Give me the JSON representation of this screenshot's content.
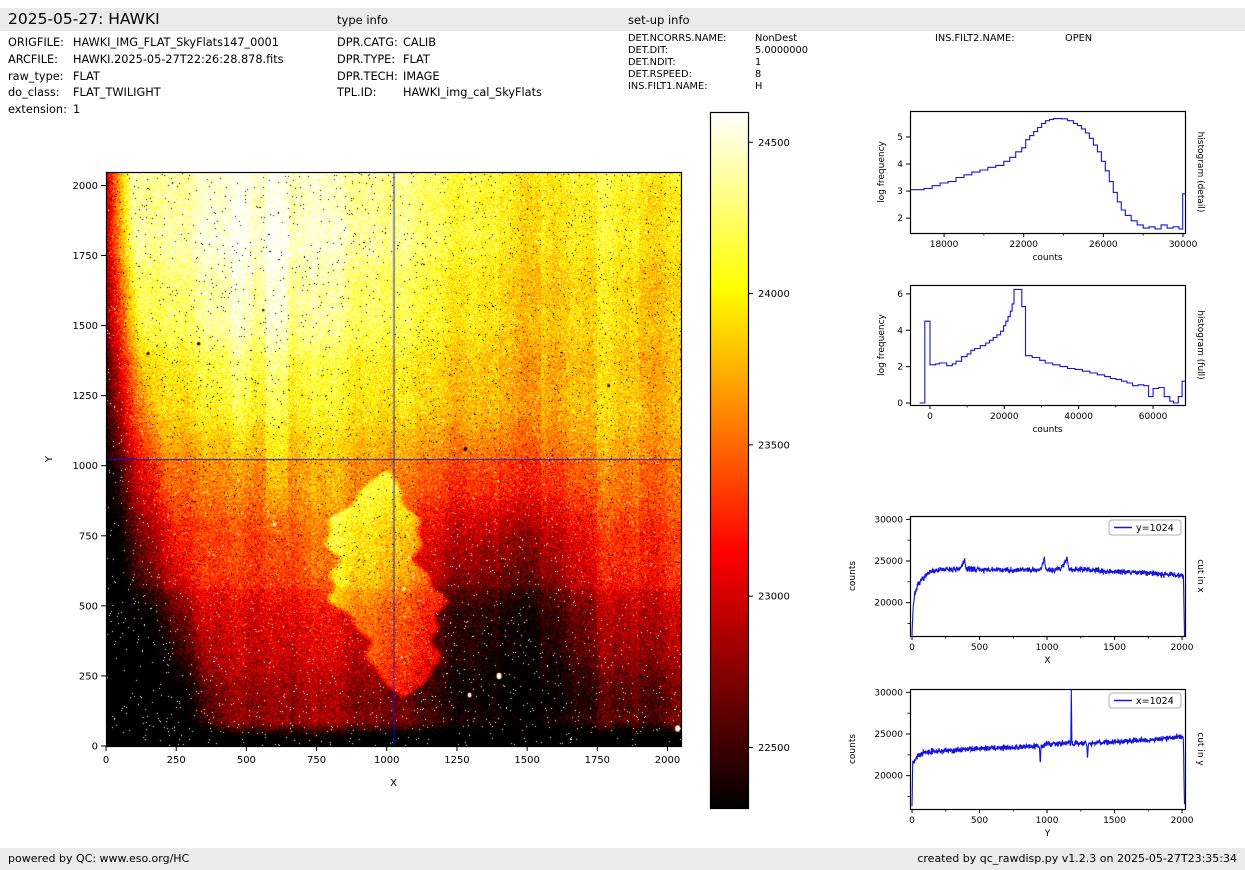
{
  "title": "2025-05-27: HAWKI",
  "sections": {
    "type_info_title": "type info",
    "setup_info_title": "set-up info"
  },
  "file_info": [
    {
      "label": "ORIGFILE:",
      "value": "HAWKI_IMG_FLAT_SkyFlats147_0001"
    },
    {
      "label": "ARCFILE:",
      "value": "HAWKI.2025-05-27T22:26:28.878.fits"
    },
    {
      "label": "raw_type:",
      "value": "FLAT"
    },
    {
      "label": "do_class:",
      "value": "FLAT_TWILIGHT"
    },
    {
      "label": "extension:",
      "value": "1"
    }
  ],
  "type_info": [
    {
      "label": "DPR.CATG:",
      "value": "CALIB"
    },
    {
      "label": "DPR.TYPE:",
      "value": "FLAT"
    },
    {
      "label": "DPR.TECH:",
      "value": "IMAGE"
    },
    {
      "label": "TPL.ID:",
      "value": "HAWKI_img_cal_SkyFlats"
    }
  ],
  "setup_info": [
    {
      "label": "DET.NCORRS.NAME:",
      "value": "NonDest"
    },
    {
      "label": "DET.DIT:",
      "value": "5.0000000"
    },
    {
      "label": "DET.NDIT:",
      "value": "1"
    },
    {
      "label": "DET.RSPEED:",
      "value": "8"
    },
    {
      "label": "INS.FILT1.NAME:",
      "value": "H"
    }
  ],
  "setup_info2": [
    {
      "label": "INS.FILT2.NAME:",
      "value": "OPEN"
    }
  ],
  "footer": {
    "left": "powered by QC: www.eso.org/HC",
    "right": "created by qc_rawdisp.py v1.2.3 on 2025-05-27T23:35:34"
  },
  "colors": {
    "accent_blue": "#1414dd",
    "bar_bg": "#ebebeb",
    "spine": "#000000"
  },
  "chart_data": [
    {
      "id": "main_image",
      "type": "heatmap",
      "colormap": "hot",
      "xlabel": "X",
      "ylabel": "Y",
      "xlim": [
        0,
        2048
      ],
      "ylim": [
        0,
        2048
      ],
      "xticks": [
        0,
        250,
        500,
        750,
        1000,
        1250,
        1500,
        1750,
        2000
      ],
      "yticks": [
        0,
        250,
        500,
        750,
        1000,
        1250,
        1500,
        1750,
        2000
      ],
      "crosshair": {
        "x": 1024,
        "y": 1024
      },
      "colorbar": {
        "vmin": 22300,
        "vmax": 24600,
        "ticks": [
          24500,
          24000,
          23500,
          23000,
          22500
        ]
      },
      "model": {
        "base": 23120,
        "grad": 900,
        "step_y": [
          [
            1024,
            130
          ],
          [
            560,
            70
          ]
        ],
        "bright_gauss": [
          [
            560,
            1800,
            470,
            420,
            600
          ],
          [
            640,
            1280,
            330,
            300,
            160
          ],
          [
            1700,
            1060,
            430,
            260,
            130
          ],
          [
            800,
            760,
            150,
            230,
            230
          ]
        ],
        "dark_gauss": [
          [
            1380,
            430,
            240,
            330,
            -480
          ],
          [
            1650,
            140,
            500,
            210,
            -430
          ],
          [
            60,
            110,
            270,
            260,
            -600
          ],
          [
            1510,
            650,
            270,
            270,
            -180
          ]
        ],
        "left_edge": {
          "w0": 45,
          "w1": 170,
          "pow": 1.6,
          "spread": 2.2,
          "depth": 1400
        },
        "bottom_edge": {
          "h": 90,
          "depth": 1100,
          "pow": 1.2
        },
        "blob": {
          "cx": 1010,
          "sway": 55,
          "sway_p": 160,
          "y0": 170,
          "y1": 985,
          "hw": 185,
          "edge": 22,
          "amp": 540,
          "wob": [
            28,
            41,
            1.3,
            16,
            15.7
          ]
        },
        "stripes": [
          [
            570,
            650,
            150,
            700
          ],
          [
            450,
            520,
            80,
            900
          ],
          [
            1400,
            1550,
            -120,
            0
          ],
          [
            1750,
            1900,
            100,
            0
          ],
          [
            660,
            730,
            -90,
            0
          ]
        ],
        "waves_x": [
          [
            45,
            53,
            0
          ],
          [
            35,
            19,
            2
          ]
        ],
        "waves_y": [
          [
            30,
            47,
            1
          ]
        ],
        "noise": 260,
        "salt": 0.012,
        "pepper": 0.012,
        "bright_spots": [
          [
            1400,
            250,
            2.5
          ],
          [
            1295,
            182,
            2
          ],
          [
            600,
            790,
            1.5
          ],
          [
            2036,
            62,
            2.5
          ],
          [
            1060,
            560,
            1.5
          ]
        ],
        "dark_spots": [
          [
            150,
            1400,
            1.6
          ],
          [
            1280,
            1060,
            2
          ],
          [
            650,
            363,
            1.5
          ],
          [
            560,
            1555,
            1.2
          ],
          [
            1790,
            1285,
            1.5
          ],
          [
            330,
            1435,
            1.8
          ]
        ]
      }
    },
    {
      "id": "histogram_detail",
      "type": "line",
      "step": true,
      "right_label": "histogram (detail)",
      "xlabel": "counts",
      "ylabel": "log frequency",
      "xlim": [
        16290,
        30100
      ],
      "ylim": [
        1.45,
        5.96
      ],
      "xticks_major": [
        18000,
        22000,
        26000,
        30000
      ],
      "xticks_minor": [
        20000,
        24000,
        28000
      ],
      "yticks_major": [
        2,
        3,
        4,
        5
      ],
      "yticks_minor": [],
      "points": [
        [
          16290,
          3.05
        ],
        [
          17000,
          3.1
        ],
        [
          17400,
          3.2
        ],
        [
          17800,
          3.3
        ],
        [
          18200,
          3.35
        ],
        [
          18600,
          3.5
        ],
        [
          19000,
          3.6
        ],
        [
          19400,
          3.7
        ],
        [
          19800,
          3.78
        ],
        [
          20200,
          3.88
        ],
        [
          20600,
          3.95
        ],
        [
          21000,
          4.1
        ],
        [
          21300,
          4.25
        ],
        [
          21600,
          4.45
        ],
        [
          21900,
          4.6
        ],
        [
          22100,
          4.9
        ],
        [
          22300,
          5.05
        ],
        [
          22500,
          5.2
        ],
        [
          22700,
          5.35
        ],
        [
          22900,
          5.5
        ],
        [
          23100,
          5.6
        ],
        [
          23300,
          5.65
        ],
        [
          23500,
          5.68
        ],
        [
          23900,
          5.67
        ],
        [
          24200,
          5.6
        ],
        [
          24500,
          5.5
        ],
        [
          24700,
          5.42
        ],
        [
          24900,
          5.3
        ],
        [
          25100,
          5.15
        ],
        [
          25300,
          4.95
        ],
        [
          25500,
          4.7
        ],
        [
          25700,
          4.45
        ],
        [
          25900,
          4.1
        ],
        [
          26100,
          3.75
        ],
        [
          26300,
          3.35
        ],
        [
          26500,
          2.95
        ],
        [
          26700,
          2.6
        ],
        [
          26900,
          2.3
        ],
        [
          27100,
          2.1
        ],
        [
          27400,
          1.9
        ],
        [
          27700,
          1.75
        ],
        [
          28000,
          1.63
        ],
        [
          28300,
          1.68
        ],
        [
          28600,
          1.6
        ],
        [
          28900,
          1.75
        ],
        [
          29200,
          1.63
        ],
        [
          29500,
          1.68
        ],
        [
          29800,
          1.6
        ],
        [
          29985,
          2.9
        ],
        [
          30100,
          2.9
        ]
      ]
    },
    {
      "id": "histogram_full",
      "type": "line",
      "step": true,
      "right_label": "histogram (full)",
      "xlabel": "counts",
      "ylabel": "log frequency",
      "xlim": [
        -5370,
        68590
      ],
      "ylim": [
        -0.11,
        6.49
      ],
      "xticks_major": [
        0,
        20000,
        40000,
        60000
      ],
      "xticks_minor": [
        10000,
        30000,
        50000
      ],
      "yticks_major": [
        0,
        2,
        4,
        6
      ],
      "yticks_minor": [],
      "points": [
        [
          -2800,
          0
        ],
        [
          -1400,
          4.5
        ],
        [
          0,
          2.1
        ],
        [
          1500,
          2.15
        ],
        [
          2500,
          2.2
        ],
        [
          4500,
          2.05
        ],
        [
          6000,
          2.15
        ],
        [
          7000,
          2.3
        ],
        [
          8500,
          2.55
        ],
        [
          10000,
          2.7
        ],
        [
          11000,
          2.9
        ],
        [
          12000,
          3.0
        ],
        [
          13500,
          3.15
        ],
        [
          15000,
          3.3
        ],
        [
          16000,
          3.45
        ],
        [
          17000,
          3.6
        ],
        [
          18000,
          3.75
        ],
        [
          19000,
          3.95
        ],
        [
          19800,
          4.25
        ],
        [
          20400,
          4.5
        ],
        [
          21000,
          4.75
        ],
        [
          21600,
          5.05
        ],
        [
          22100,
          5.45
        ],
        [
          22600,
          6.25
        ],
        [
          24700,
          5.3
        ],
        [
          25700,
          2.6
        ],
        [
          27500,
          2.5
        ],
        [
          29500,
          2.35
        ],
        [
          31000,
          2.2
        ],
        [
          33000,
          2.1
        ],
        [
          35000,
          2.0
        ],
        [
          37000,
          1.9
        ],
        [
          39000,
          1.85
        ],
        [
          41000,
          1.75
        ],
        [
          43000,
          1.65
        ],
        [
          45000,
          1.55
        ],
        [
          47000,
          1.45
        ],
        [
          48500,
          1.35
        ],
        [
          50000,
          1.3
        ],
        [
          51500,
          1.2
        ],
        [
          53000,
          1.1
        ],
        [
          54500,
          0.95
        ],
        [
          56000,
          1.0
        ],
        [
          57500,
          0.95
        ],
        [
          58800,
          0.35
        ],
        [
          60000,
          0.8
        ],
        [
          61500,
          0.85
        ],
        [
          63000,
          0.35
        ],
        [
          64500,
          0.1
        ],
        [
          65500,
          0.0
        ],
        [
          66800,
          0.35
        ],
        [
          67800,
          1.2
        ],
        [
          68590,
          1.2
        ]
      ]
    },
    {
      "id": "cut_in_x",
      "type": "line",
      "step": false,
      "legend": "y=1024",
      "right_label": "cut in x",
      "xlabel": "X",
      "ylabel": "counts",
      "xlim": [
        -15,
        2022
      ],
      "ylim": [
        16000,
        30400
      ],
      "xticks_major": [
        0,
        500,
        1000,
        1500,
        2000
      ],
      "xticks_minor": [
        250,
        750,
        1250,
        1750
      ],
      "yticks_major": [
        20000,
        25000,
        30000
      ],
      "yticks_minor": [
        17500,
        22500,
        27500
      ],
      "noise_sigma": 330,
      "noise_seed": 7,
      "base_points": [
        [
          0,
          16200
        ],
        [
          8,
          19500
        ],
        [
          20,
          21000
        ],
        [
          40,
          22000
        ],
        [
          70,
          22700
        ],
        [
          100,
          23200
        ],
        [
          140,
          23700
        ],
        [
          180,
          23900
        ],
        [
          250,
          24000
        ],
        [
          350,
          23950
        ],
        [
          390,
          25100
        ],
        [
          400,
          24000
        ],
        [
          450,
          24050
        ],
        [
          550,
          23900
        ],
        [
          650,
          23950
        ],
        [
          750,
          23900
        ],
        [
          850,
          24000
        ],
        [
          950,
          23900
        ],
        [
          980,
          25300
        ],
        [
          990,
          24000
        ],
        [
          1050,
          23950
        ],
        [
          1100,
          24050
        ],
        [
          1150,
          25400
        ],
        [
          1160,
          24050
        ],
        [
          1200,
          24000
        ],
        [
          1300,
          23950
        ],
        [
          1400,
          23800
        ],
        [
          1500,
          23750
        ],
        [
          1600,
          23700
        ],
        [
          1700,
          23600
        ],
        [
          1800,
          23500
        ],
        [
          1900,
          23400
        ],
        [
          1975,
          23300
        ],
        [
          2010,
          23250
        ],
        [
          2018,
          16300
        ]
      ]
    },
    {
      "id": "cut_in_y",
      "type": "line",
      "step": false,
      "legend": "x=1024",
      "right_label": "cut in y",
      "xlabel": "Y",
      "ylabel": "counts",
      "xlim": [
        -15,
        2022
      ],
      "ylim": [
        16000,
        30400
      ],
      "xticks_major": [
        0,
        500,
        1000,
        1500,
        2000
      ],
      "xticks_minor": [
        250,
        750,
        1250,
        1750
      ],
      "yticks_major": [
        20000,
        25000,
        30000
      ],
      "yticks_minor": [
        17500,
        22500,
        27500
      ],
      "noise_sigma": 330,
      "noise_seed": 13,
      "base_points": [
        [
          0,
          16500
        ],
        [
          5,
          21500
        ],
        [
          30,
          22200
        ],
        [
          80,
          22700
        ],
        [
          150,
          22900
        ],
        [
          250,
          23000
        ],
        [
          350,
          23100
        ],
        [
          450,
          23200
        ],
        [
          550,
          23300
        ],
        [
          650,
          23350
        ],
        [
          750,
          23400
        ],
        [
          850,
          23500
        ],
        [
          900,
          23550
        ],
        [
          944,
          23500
        ],
        [
          950,
          21600
        ],
        [
          956,
          23500
        ],
        [
          1000,
          23900
        ],
        [
          1050,
          23800
        ],
        [
          1100,
          23850
        ],
        [
          1150,
          23900
        ],
        [
          1176,
          23900
        ],
        [
          1180,
          30600
        ],
        [
          1184,
          23900
        ],
        [
          1250,
          23850
        ],
        [
          1294,
          23850
        ],
        [
          1300,
          21900
        ],
        [
          1306,
          23850
        ],
        [
          1400,
          24000
        ],
        [
          1500,
          24100
        ],
        [
          1600,
          24150
        ],
        [
          1700,
          24250
        ],
        [
          1800,
          24350
        ],
        [
          1900,
          24500
        ],
        [
          1950,
          24600
        ],
        [
          2000,
          24700
        ],
        [
          2010,
          24500
        ],
        [
          2018,
          16500
        ]
      ]
    }
  ]
}
